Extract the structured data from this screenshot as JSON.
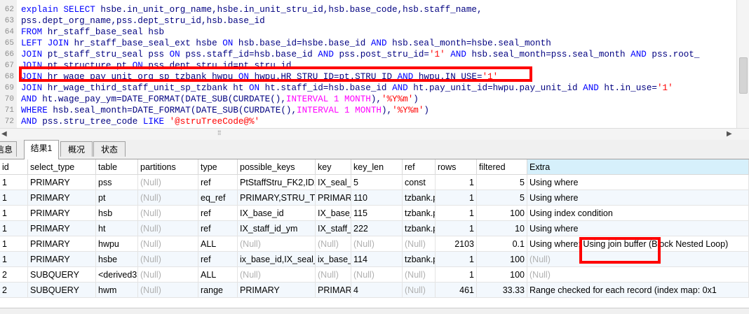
{
  "editor": {
    "lines": [
      {
        "num": "62",
        "segments": [
          {
            "t": "explain SELECT ",
            "c": "#0000ff"
          },
          {
            "t": "hsbe.in_unit_org_name,hsbe.in_unit_stru_id,hsb.base_code,hsb.staff_name,",
            "c": "#000080"
          }
        ]
      },
      {
        "num": "63",
        "segments": [
          {
            "t": "pss.dept_org_name,pss.dept_stru_id,hsb.base_id",
            "c": "#000080"
          }
        ]
      },
      {
        "num": "64",
        "segments": [
          {
            "t": "FROM ",
            "c": "#0000ff"
          },
          {
            "t": "hr_staff_base_seal hsb",
            "c": "#000080"
          }
        ]
      },
      {
        "num": "65",
        "segments": [
          {
            "t": "LEFT JOIN ",
            "c": "#0000ff"
          },
          {
            "t": "hr_staff_base_seal_ext hsbe ",
            "c": "#000080"
          },
          {
            "t": "ON ",
            "c": "#0000ff"
          },
          {
            "t": "hsb.base_id=hsbe.base_id ",
            "c": "#000080"
          },
          {
            "t": "AND ",
            "c": "#0000ff"
          },
          {
            "t": "hsb.seal_month=hsbe.seal_month",
            "c": "#000080"
          }
        ]
      },
      {
        "num": "66",
        "segments": [
          {
            "t": "JOIN ",
            "c": "#0000ff"
          },
          {
            "t": "pt_staff_stru_seal pss ",
            "c": "#000080"
          },
          {
            "t": "ON ",
            "c": "#0000ff"
          },
          {
            "t": "pss.staff_id=hsb.base_id ",
            "c": "#000080"
          },
          {
            "t": "AND ",
            "c": "#0000ff"
          },
          {
            "t": "pss.post_stru_id=",
            "c": "#000080"
          },
          {
            "t": "'1' ",
            "c": "#ff0000"
          },
          {
            "t": "AND ",
            "c": "#0000ff"
          },
          {
            "t": "hsb.seal_month=pss.seal_month ",
            "c": "#000080"
          },
          {
            "t": "AND ",
            "c": "#0000ff"
          },
          {
            "t": "pss.root_",
            "c": "#000080"
          }
        ]
      },
      {
        "num": "67",
        "segments": [
          {
            "t": "JOIN ",
            "c": "#0000ff"
          },
          {
            "t": "pt_structure pt ",
            "c": "#000080"
          },
          {
            "t": "ON ",
            "c": "#0000ff"
          },
          {
            "t": "pss.dept_stru_id=pt.stru_id",
            "c": "#000080"
          }
        ]
      },
      {
        "num": "68",
        "segments": [
          {
            "t": "JOIN ",
            "c": "#0000ff"
          },
          {
            "t": "hr_wage_pay_unit_org_sp_tzbank hwpu ",
            "c": "#000080"
          },
          {
            "t": "ON ",
            "c": "#0000ff"
          },
          {
            "t": "hwpu.HR_STRU_ID=pt.STRU_ID ",
            "c": "#000080"
          },
          {
            "t": "AND ",
            "c": "#0000ff"
          },
          {
            "t": "hwpu.IN_USE=",
            "c": "#000080"
          },
          {
            "t": "'1'",
            "c": "#ff0000"
          }
        ]
      },
      {
        "num": "69",
        "segments": [
          {
            "t": "JOIN ",
            "c": "#0000ff"
          },
          {
            "t": "hr_wage_third_staff_unit_sp_tzbank ht ",
            "c": "#000080"
          },
          {
            "t": "ON ",
            "c": "#0000ff"
          },
          {
            "t": "ht.staff_id=hsb.base_id ",
            "c": "#000080"
          },
          {
            "t": "AND ",
            "c": "#0000ff"
          },
          {
            "t": "ht.pay_unit_id=hwpu.pay_unit_id ",
            "c": "#000080"
          },
          {
            "t": "AND ",
            "c": "#0000ff"
          },
          {
            "t": "ht.in_use=",
            "c": "#000080"
          },
          {
            "t": "'1'",
            "c": "#ff0000"
          }
        ]
      },
      {
        "num": "70",
        "segments": [
          {
            "t": "AND ",
            "c": "#0000ff"
          },
          {
            "t": "ht.wage_pay_ym=DATE_FORMAT(DATE_SUB(CURDATE(),",
            "c": "#000080"
          },
          {
            "t": "INTERVAL 1 MONTH",
            "c": "#ff00ff"
          },
          {
            "t": "),",
            "c": "#000080"
          },
          {
            "t": "'%Y%m'",
            "c": "#ff0000"
          },
          {
            "t": ")",
            "c": "#000080"
          }
        ]
      },
      {
        "num": "71",
        "segments": [
          {
            "t": "WHERE ",
            "c": "#0000ff"
          },
          {
            "t": "hsb.seal_month=DATE_FORMAT(DATE_SUB(CURDATE(),",
            "c": "#000080"
          },
          {
            "t": "INTERVAL 1 MONTH",
            "c": "#ff00ff"
          },
          {
            "t": "),",
            "c": "#000080"
          },
          {
            "t": "'%Y%m'",
            "c": "#ff0000"
          },
          {
            "t": ")",
            "c": "#000080"
          }
        ]
      },
      {
        "num": "72",
        "segments": [
          {
            "t": "AND ",
            "c": "#0000ff"
          },
          {
            "t": "pss.stru_tree_code ",
            "c": "#000080"
          },
          {
            "t": "LIKE ",
            "c": "#0000ff"
          },
          {
            "t": "'@struTreeCode@%'",
            "c": "#ff0000"
          }
        ]
      }
    ]
  },
  "tabs": [
    "信息",
    "结果1",
    "概况",
    "状态"
  ],
  "grid": {
    "columns": [
      "id",
      "select_type",
      "table",
      "partitions",
      "type",
      "possible_keys",
      "key",
      "key_len",
      "ref",
      "rows",
      "filtered",
      "Extra"
    ],
    "rows": [
      [
        "1",
        "PRIMARY",
        "pss",
        "(Null)",
        "ref",
        "PtStaffStru_FK2,IDX",
        "IX_seal_r",
        "5",
        "const",
        "1",
        "5",
        "Using where"
      ],
      [
        "1",
        "PRIMARY",
        "pt",
        "(Null)",
        "eq_ref",
        "PRIMARY,STRU_TR",
        "PRIMARY",
        "110",
        "tzbank.p",
        "1",
        "5",
        "Using where"
      ],
      [
        "1",
        "PRIMARY",
        "hsb",
        "(Null)",
        "ref",
        "IX_base_id",
        "IX_base_",
        "115",
        "tzbank.p",
        "1",
        "100",
        "Using index condition"
      ],
      [
        "1",
        "PRIMARY",
        "ht",
        "(Null)",
        "ref",
        "IX_staff_id_ym",
        "IX_staff_",
        "222",
        "tzbank.p",
        "1",
        "10",
        "Using where"
      ],
      [
        "1",
        "PRIMARY",
        "hwpu",
        "(Null)",
        "ALL",
        "(Null)",
        "(Null)",
        "(Null)",
        "(Null)",
        "2103",
        "0.1",
        "Using where; Using join buffer (Block Nested Loop)"
      ],
      [
        "1",
        "PRIMARY",
        "hsbe",
        "(Null)",
        "ref",
        "ix_base_id,IX_seal_r",
        "ix_base_",
        "114",
        "tzbank.p",
        "1",
        "100",
        "(Null)"
      ],
      [
        "2",
        "SUBQUERY",
        "<derived3>",
        "(Null)",
        "ALL",
        "(Null)",
        "(Null)",
        "(Null)",
        "(Null)",
        "1",
        "100",
        "(Null)"
      ],
      [
        "2",
        "SUBQUERY",
        "hwm",
        "(Null)",
        "range",
        "PRIMARY",
        "PRIMAR",
        "4",
        "(Null)",
        "461",
        "33.33",
        "Range checked for each record (index map: 0x1"
      ]
    ]
  }
}
